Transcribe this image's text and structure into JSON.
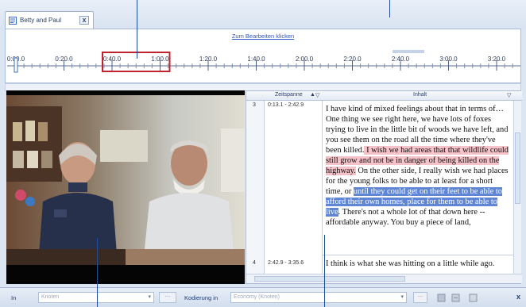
{
  "tab": {
    "label": "Betty and Paul",
    "close_glyph": "x"
  },
  "timeline": {
    "edit_link": "Zum Bearbeiten klicken",
    "ticks": [
      "0:00.0",
      "0:20.0",
      "0:40.0",
      "1:00.0",
      "1:20.0",
      "1:40.0",
      "2:00.0",
      "2:20.0",
      "2:40.0",
      "3:00.0",
      "3:20.0"
    ],
    "highlight_range": [
      "0:40.0",
      "1:00.0"
    ],
    "highlight_color": "#c0232e"
  },
  "grid": {
    "col_time_header": "Zeitspanne",
    "col_text_header": "Inhalt",
    "sort_glyph": "▲",
    "filter_glyph": "▽",
    "rows": [
      {
        "num": "3",
        "time": "0:13.1 - 2:42.9"
      },
      {
        "num": "4",
        "time": "2:42.9 - 3:35.6"
      }
    ],
    "row3_parts": {
      "p1": "I have kind of mixed feelings about that in terms of… One thing we see right here, we have lots of foxes trying to live in the little bit of woods we have left, and you see them on the road all the time where they've been killed.",
      "p2": " I wish we had areas that that wildlife could still grow and not be in danger of being killed on the highway.",
      "p3": " On the other side, I really wish we had places for the young folks to be able to at least for a short time, or ",
      "p4": "until they could get on their feet to be able to afford their own homes, place for them to be able to live",
      "p5": ". There's not a whole lot of that down here -- affordable anyway. You buy a piece of land,"
    },
    "row4_text": "I think is what she was hitting on a little while ago."
  },
  "bottom": {
    "in_label": "In",
    "in_value": "Knoten",
    "coding_label": "Kodierung in",
    "coding_value": "Economy (Knoten)",
    "close_glyph": "x"
  },
  "colors": {
    "accent": "#1f4e9a",
    "highlight_pink": "#f4c2c8",
    "highlight_blue": "#5f86d4"
  }
}
